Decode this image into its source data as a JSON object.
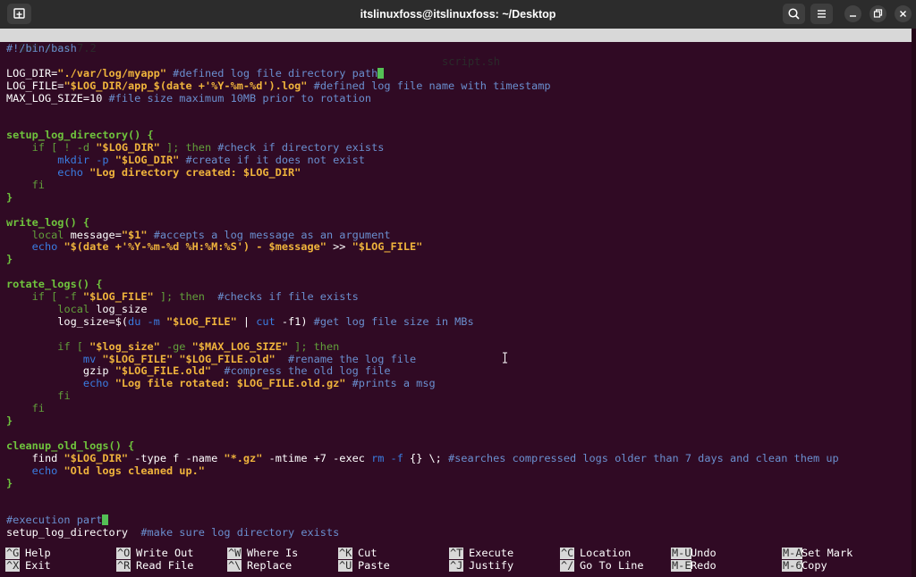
{
  "window": {
    "title": "itslinuxfoss@itslinuxfoss: ~/Desktop"
  },
  "nano": {
    "version": "GNU nano 7.2",
    "filename": "script.sh"
  },
  "code_lines": [
    {
      "row": 0,
      "parts": [
        {
          "t": "#!/bin/bash",
          "c": "cm"
        }
      ]
    },
    {
      "row": 2,
      "parts": [
        {
          "t": "LOG_DIR="
        },
        {
          "t": "\"./var/log/myapp\"",
          "c": "str"
        },
        {
          "t": " "
        },
        {
          "t": "#defined log file directory path",
          "c": "cm"
        },
        {
          "cursor": true
        }
      ]
    },
    {
      "row": 3,
      "parts": [
        {
          "t": "LOG_FILE="
        },
        {
          "t": "\"$LOG_DIR/app_$(date +'%Y-%m-%d').log\"",
          "c": "str"
        },
        {
          "t": " "
        },
        {
          "t": "#defined log file name with timestamp",
          "c": "cm"
        }
      ]
    },
    {
      "row": 4,
      "parts": [
        {
          "t": "MAX_LOG_SIZE=10 "
        },
        {
          "t": "#file size maximum 10MB prior to rotation",
          "c": "cm"
        }
      ]
    },
    {
      "row": 7,
      "parts": [
        {
          "t": "setup_log_directory() {",
          "c": "fn"
        }
      ]
    },
    {
      "row": 8,
      "parts": [
        {
          "t": "    "
        },
        {
          "t": "if [ ! -d ",
          "c": "kw"
        },
        {
          "t": "\"$LOG_DIR\"",
          "c": "str"
        },
        {
          "t": " ]; then ",
          "c": "kw"
        },
        {
          "t": "#check if directory exists",
          "c": "cm"
        }
      ]
    },
    {
      "row": 9,
      "parts": [
        {
          "t": "        "
        },
        {
          "t": "mkdir -p ",
          "c": "cmd"
        },
        {
          "t": "\"$LOG_DIR\"",
          "c": "str"
        },
        {
          "t": " "
        },
        {
          "t": "#create if it does not exist",
          "c": "cm"
        }
      ]
    },
    {
      "row": 10,
      "parts": [
        {
          "t": "        "
        },
        {
          "t": "echo ",
          "c": "cmd"
        },
        {
          "t": "\"Log directory created: $LOG_DIR\"",
          "c": "str"
        }
      ]
    },
    {
      "row": 11,
      "parts": [
        {
          "t": "    "
        },
        {
          "t": "fi",
          "c": "kw"
        }
      ]
    },
    {
      "row": 12,
      "parts": [
        {
          "t": "}",
          "c": "fn"
        }
      ]
    },
    {
      "row": 14,
      "parts": [
        {
          "t": "write_log() {",
          "c": "fn"
        }
      ]
    },
    {
      "row": 15,
      "parts": [
        {
          "t": "    "
        },
        {
          "t": "local ",
          "c": "kw"
        },
        {
          "t": "message="
        },
        {
          "t": "\"$1\"",
          "c": "str"
        },
        {
          "t": " "
        },
        {
          "t": "#accepts a log message as an argument",
          "c": "cm"
        }
      ]
    },
    {
      "row": 16,
      "parts": [
        {
          "t": "    "
        },
        {
          "t": "echo ",
          "c": "cmd"
        },
        {
          "t": "\"$(date +'%Y-%m-%d %H:%M:%S') - $message\"",
          "c": "str"
        },
        {
          "t": " >> "
        },
        {
          "t": "\"$LOG_FILE\"",
          "c": "str"
        }
      ]
    },
    {
      "row": 17,
      "parts": [
        {
          "t": "}",
          "c": "fn"
        }
      ]
    },
    {
      "row": 19,
      "parts": [
        {
          "t": "rotate_logs() {",
          "c": "fn"
        }
      ]
    },
    {
      "row": 20,
      "parts": [
        {
          "t": "    "
        },
        {
          "t": "if [ -f ",
          "c": "kw"
        },
        {
          "t": "\"$LOG_FILE\"",
          "c": "str"
        },
        {
          "t": " ]; then  ",
          "c": "kw"
        },
        {
          "t": "#checks if file exists",
          "c": "cm"
        }
      ]
    },
    {
      "row": 21,
      "parts": [
        {
          "t": "        "
        },
        {
          "t": "local ",
          "c": "kw"
        },
        {
          "t": "log_size"
        }
      ]
    },
    {
      "row": 22,
      "parts": [
        {
          "t": "        log_size=$("
        },
        {
          "t": "du -m ",
          "c": "cmd"
        },
        {
          "t": "\"$LOG_FILE\"",
          "c": "str"
        },
        {
          "t": " | "
        },
        {
          "t": "cut ",
          "c": "cmd"
        },
        {
          "t": "-f1) "
        },
        {
          "t": "#get log file size in MBs",
          "c": "cm"
        }
      ]
    },
    {
      "row": 24,
      "parts": [
        {
          "t": "        "
        },
        {
          "t": "if [ ",
          "c": "kw"
        },
        {
          "t": "\"$log_size\"",
          "c": "str"
        },
        {
          "t": " -ge ",
          "c": "kw"
        },
        {
          "t": "\"$MAX_LOG_SIZE\"",
          "c": "str"
        },
        {
          "t": " ]; then",
          "c": "kw"
        }
      ]
    },
    {
      "row": 25,
      "parts": [
        {
          "t": "            "
        },
        {
          "t": "mv ",
          "c": "cmd"
        },
        {
          "t": "\"$LOG_FILE\"",
          "c": "str"
        },
        {
          "t": " "
        },
        {
          "t": "\"$LOG_FILE.old\"",
          "c": "str"
        },
        {
          "t": "  "
        },
        {
          "t": "#rename the log file",
          "c": "cm"
        }
      ]
    },
    {
      "row": 26,
      "parts": [
        {
          "t": "            gzip "
        },
        {
          "t": "\"$LOG_FILE.old\"",
          "c": "str"
        },
        {
          "t": "  "
        },
        {
          "t": "#compress the old log file",
          "c": "cm"
        }
      ]
    },
    {
      "row": 27,
      "parts": [
        {
          "t": "            "
        },
        {
          "t": "echo ",
          "c": "cmd"
        },
        {
          "t": "\"Log file rotated: $LOG_FILE.old.gz\"",
          "c": "str"
        },
        {
          "t": " "
        },
        {
          "t": "#prints a msg",
          "c": "cm"
        }
      ]
    },
    {
      "row": 28,
      "parts": [
        {
          "t": "        "
        },
        {
          "t": "fi",
          "c": "kw"
        }
      ]
    },
    {
      "row": 29,
      "parts": [
        {
          "t": "    "
        },
        {
          "t": "fi",
          "c": "kw"
        }
      ]
    },
    {
      "row": 30,
      "parts": [
        {
          "t": "}",
          "c": "fn"
        }
      ]
    },
    {
      "row": 32,
      "parts": [
        {
          "t": "cleanup_old_logs() {",
          "c": "fn"
        }
      ]
    },
    {
      "row": 33,
      "parts": [
        {
          "t": "    find "
        },
        {
          "t": "\"$LOG_DIR\"",
          "c": "str"
        },
        {
          "t": " -type f -name "
        },
        {
          "t": "\"*.gz\"",
          "c": "str"
        },
        {
          "t": " -mtime +7 -exec "
        },
        {
          "t": "rm -f ",
          "c": "cmd"
        },
        {
          "t": "{} \\; "
        },
        {
          "t": "#searches compressed logs older than 7 days and clean them up",
          "c": "cm"
        }
      ]
    },
    {
      "row": 34,
      "parts": [
        {
          "t": "    "
        },
        {
          "t": "echo ",
          "c": "cmd"
        },
        {
          "t": "\"Old logs cleaned up.\"",
          "c": "str"
        }
      ]
    },
    {
      "row": 35,
      "parts": [
        {
          "t": "}",
          "c": "fn"
        }
      ]
    },
    {
      "row": 38,
      "parts": [
        {
          "t": "#execution part",
          "c": "cm"
        },
        {
          "cursor": true
        }
      ]
    },
    {
      "row": 39,
      "parts": [
        {
          "t": "setup_log_directory  "
        },
        {
          "t": "#make sure log directory exists",
          "c": "cm"
        }
      ]
    }
  ],
  "shortcuts": [
    {
      "key": "^G",
      "label": "Help",
      "name": "help"
    },
    {
      "key": "^X",
      "label": "Exit",
      "name": "exit"
    },
    {
      "key": "^O",
      "label": "Write Out",
      "name": "write-out"
    },
    {
      "key": "^R",
      "label": "Read File",
      "name": "read-file"
    },
    {
      "key": "^W",
      "label": "Where Is",
      "name": "where-is"
    },
    {
      "key": "^\\",
      "label": "Replace",
      "name": "replace"
    },
    {
      "key": "^K",
      "label": "Cut",
      "name": "cut"
    },
    {
      "key": "^U",
      "label": "Paste",
      "name": "paste"
    },
    {
      "key": "^T",
      "label": "Execute",
      "name": "execute"
    },
    {
      "key": "^J",
      "label": "Justify",
      "name": "justify"
    },
    {
      "key": "^C",
      "label": "Location",
      "name": "location"
    },
    {
      "key": "^/",
      "label": "Go To Line",
      "name": "go-to-line"
    },
    {
      "key": "M-U",
      "label": "Undo",
      "name": "undo"
    },
    {
      "key": "M-E",
      "label": "Redo",
      "name": "redo"
    },
    {
      "key": "M-A",
      "label": "Set Mark",
      "name": "set-mark"
    },
    {
      "key": "M-6",
      "label": "Copy",
      "name": "copy"
    }
  ],
  "colors": {
    "background": "#300a24",
    "comment": "#6a8fcf",
    "keyword": "#62a03b",
    "string": "#f0b43c",
    "function": "#6fc43d",
    "command": "#3a7de2",
    "cursor": "#54c055",
    "header_bar": "#d8d8d8"
  },
  "icons": {
    "new_tab": "new-tab-icon",
    "search": "search-icon",
    "menu": "hamburger-menu-icon",
    "minimize": "minimize-icon",
    "maximize": "restore-icon",
    "close": "close-icon",
    "pointer": "text-ibeam-cursor-icon"
  }
}
